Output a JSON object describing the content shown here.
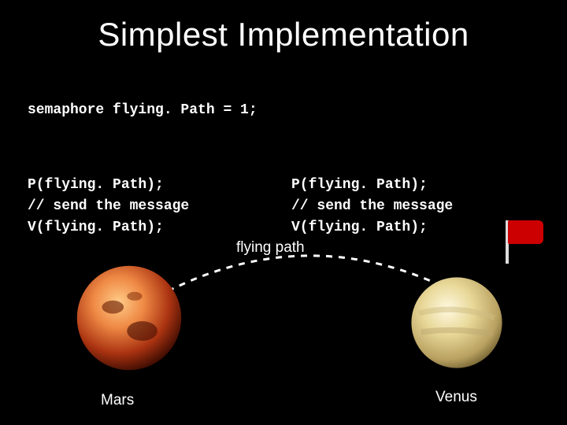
{
  "title": "Simplest Implementation",
  "code": {
    "declaration": "semaphore flying. Path = 1;",
    "left": [
      "P(flying. Path);",
      "// send the message",
      "V(flying. Path);"
    ],
    "right": [
      "P(flying. Path);",
      "// send the message",
      "V(flying. Path);"
    ]
  },
  "diagram": {
    "path_label": "flying path",
    "left_planet": "Mars",
    "right_planet": "Venus"
  }
}
